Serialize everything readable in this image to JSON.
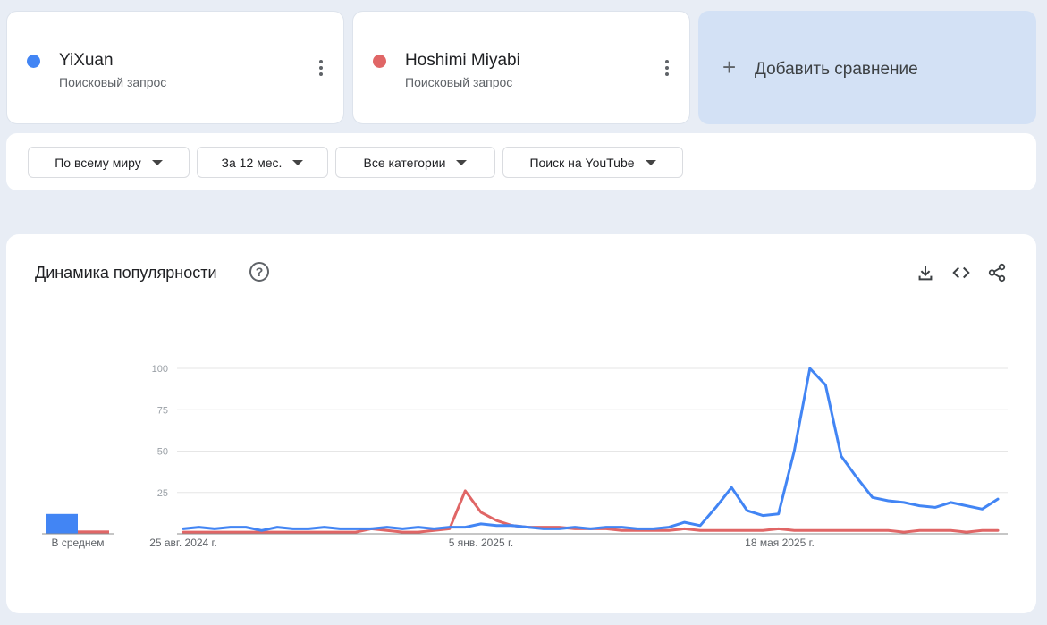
{
  "terms": [
    {
      "name": "YiXuan",
      "type": "Поисковый запрос",
      "color": "#4285f4"
    },
    {
      "name": "Hoshimi Miyabi",
      "type": "Поисковый запрос",
      "color": "#e06666"
    }
  ],
  "add_comparison": {
    "label": "Добавить сравнение",
    "icon": "plus-icon"
  },
  "filters": [
    {
      "label": "По всему миру"
    },
    {
      "label": "За 12 мес."
    },
    {
      "label": "Все категории"
    },
    {
      "label": "Поиск на YouTube"
    }
  ],
  "chart_section": {
    "title": "Динамика популярности",
    "icons": [
      "help-icon",
      "download-icon",
      "embed-icon",
      "share-icon"
    ]
  },
  "chart_data": {
    "type": "line",
    "y_ticks": [
      "100",
      "75",
      "50",
      "25"
    ],
    "ylim": [
      0,
      100
    ],
    "x_tick_labels": [
      "25 авг. 2024 г.",
      "5 янв. 2025 г.",
      "18 мая 2025 г."
    ],
    "average_label": "В среднем",
    "averages": [
      12,
      2
    ],
    "grid": true,
    "series": [
      {
        "name": "YiXuan",
        "color": "#4285f4",
        "values": [
          3,
          4,
          3,
          4,
          4,
          2,
          4,
          3,
          3,
          4,
          3,
          3,
          3,
          4,
          3,
          4,
          3,
          4,
          4,
          6,
          5,
          5,
          4,
          3,
          3,
          4,
          3,
          4,
          4,
          3,
          3,
          4,
          7,
          5,
          16,
          28,
          14,
          11,
          12,
          50,
          100,
          90,
          47,
          34,
          22,
          20,
          19,
          17,
          16,
          19,
          17,
          15,
          21
        ]
      },
      {
        "name": "Hoshimi Miyabi",
        "color": "#e06666",
        "values": [
          1,
          1,
          1,
          1,
          1,
          1,
          1,
          1,
          1,
          1,
          1,
          1,
          3,
          2,
          1,
          1,
          2,
          3,
          26,
          13,
          8,
          5,
          4,
          4,
          4,
          3,
          3,
          3,
          2,
          2,
          2,
          2,
          3,
          2,
          2,
          2,
          2,
          2,
          3,
          2,
          2,
          2,
          2,
          2,
          2,
          2,
          1,
          2,
          2,
          2,
          1,
          2,
          2
        ]
      }
    ]
  }
}
